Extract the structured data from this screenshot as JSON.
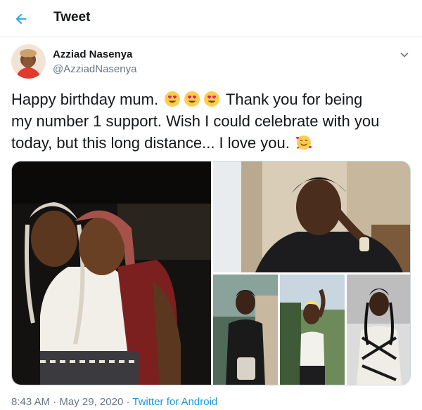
{
  "header": {
    "title": "Tweet"
  },
  "author": {
    "name": "Azziad Nasenya",
    "handle": "@AzziadNasenya"
  },
  "tweet": {
    "line1_a": "Happy birthday mum. ",
    "line1_b": " Thank you for being",
    "line2": "my number 1 support. Wish I could celebrate with you",
    "line3_a": "today, but this long distance... I love you. ",
    "emoji_names": [
      "heart-eyes-emoji",
      "heart-eyes-emoji",
      "heart-eyes-emoji",
      "smiling-face-with-hearts-emoji"
    ]
  },
  "meta": {
    "time": "8:43 AM",
    "sep1": " · ",
    "date": "May 29, 2020",
    "sep2": " · ",
    "source": "Twitter for Android"
  },
  "colors": {
    "accent": "#1da1f2",
    "secondary_text": "#657786",
    "divider": "#e6ecf0"
  }
}
